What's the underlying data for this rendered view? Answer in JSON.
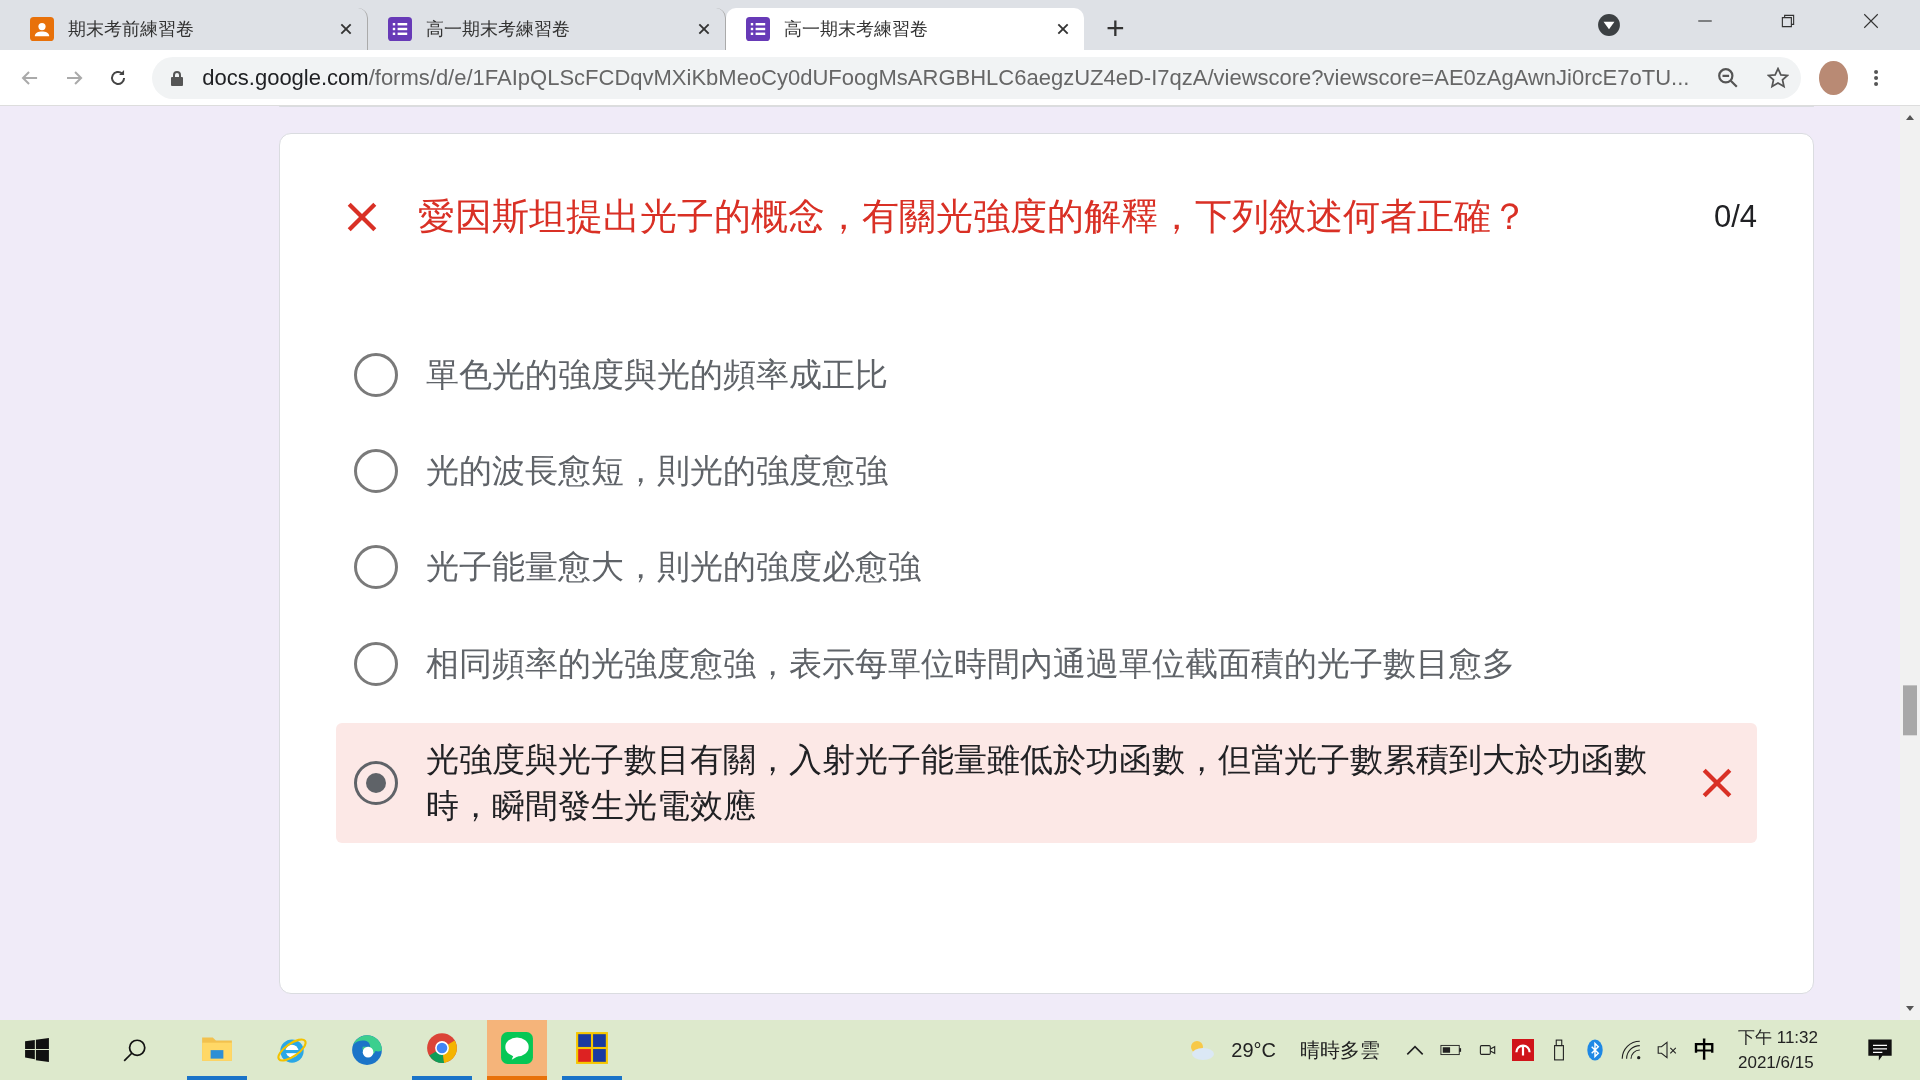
{
  "browser": {
    "tabs": [
      {
        "kind": "classroom",
        "title": "期末考前練習卷",
        "selected": false
      },
      {
        "kind": "forms",
        "title": "高一期末考練習卷",
        "selected": false
      },
      {
        "kind": "forms",
        "title": "高一期末考練習卷",
        "selected": true
      }
    ],
    "new_tab": "+",
    "url_host": "docs.google.com",
    "url_path": "/forms/d/e/1FAIpQLScFCDqvMXiKbMeoCy0dUFoogMsARGBHLC6aegzUZ4eD-I7qzA/viewscore?viewscore=AE0zAgAwnJi0rcE7oTU..."
  },
  "question": {
    "correct": false,
    "text": "愛因斯坦提出光子的概念，有關光強度的解釋，下列敘述何者正確？",
    "score": "0/4",
    "options": [
      {
        "text": "單色光的強度與光的頻率成正比",
        "selected": false
      },
      {
        "text": "光的波長愈短，則光的強度愈強",
        "selected": false
      },
      {
        "text": "光子能量愈大，則光的強度必愈強",
        "selected": false
      },
      {
        "text": "相同頻率的光強度愈強，表示每單位時間內通過單位截面積的光子數目愈多",
        "selected": false
      },
      {
        "text": "光強度與光子數目有關，入射光子能量雖低於功函數，但當光子數累積到大於功函數時，瞬間發生光電效應",
        "selected": true
      }
    ]
  },
  "taskbar": {
    "apps": [
      {
        "kind": "explorer",
        "running": true,
        "selected": false
      },
      {
        "kind": "ie",
        "running": false,
        "selected": false
      },
      {
        "kind": "edge",
        "running": false,
        "selected": false
      },
      {
        "kind": "chrome",
        "running": true,
        "selected": false
      },
      {
        "kind": "line",
        "running": true,
        "selected": true
      },
      {
        "kind": "quiz",
        "running": true,
        "selected": false
      }
    ],
    "temperature": "29°C",
    "weather": "晴時多雲",
    "ime": "中",
    "time": "下午 11:32",
    "date": "2021/6/15"
  }
}
